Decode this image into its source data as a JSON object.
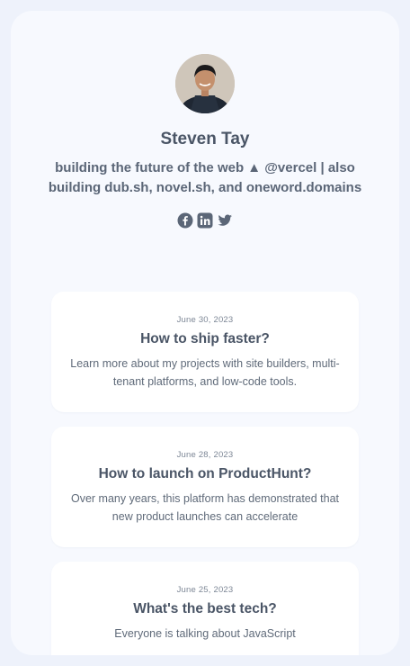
{
  "profile": {
    "name": "Steven Tay",
    "bio": "building the future of the web ▲ @vercel | also building dub.sh, novel.sh, and oneword.domains",
    "avatar_icon": "profile-photo",
    "socials": [
      {
        "name": "facebook",
        "icon": "facebook-icon"
      },
      {
        "name": "linkedin",
        "icon": "linkedin-icon"
      },
      {
        "name": "twitter",
        "icon": "twitter-icon"
      }
    ]
  },
  "posts": [
    {
      "date": "June 30, 2023",
      "title": "How to ship faster?",
      "description": "Learn more about my projects with site builders, multi-tenant platforms, and low-code tools."
    },
    {
      "date": "June 28, 2023",
      "title": "How to launch on ProductHunt?",
      "description": "Over many years, this platform has demonstrated that new product launches can accelerate"
    },
    {
      "date": "June 25, 2023",
      "title": "What's the best tech?",
      "description": "Everyone is talking about JavaScript"
    }
  ],
  "colors": {
    "page_bg": "#eef2fb",
    "card_bg": "#f7f9fe",
    "post_bg": "#ffffff",
    "text_primary": "#4a5566",
    "icon": "#5b6677"
  }
}
